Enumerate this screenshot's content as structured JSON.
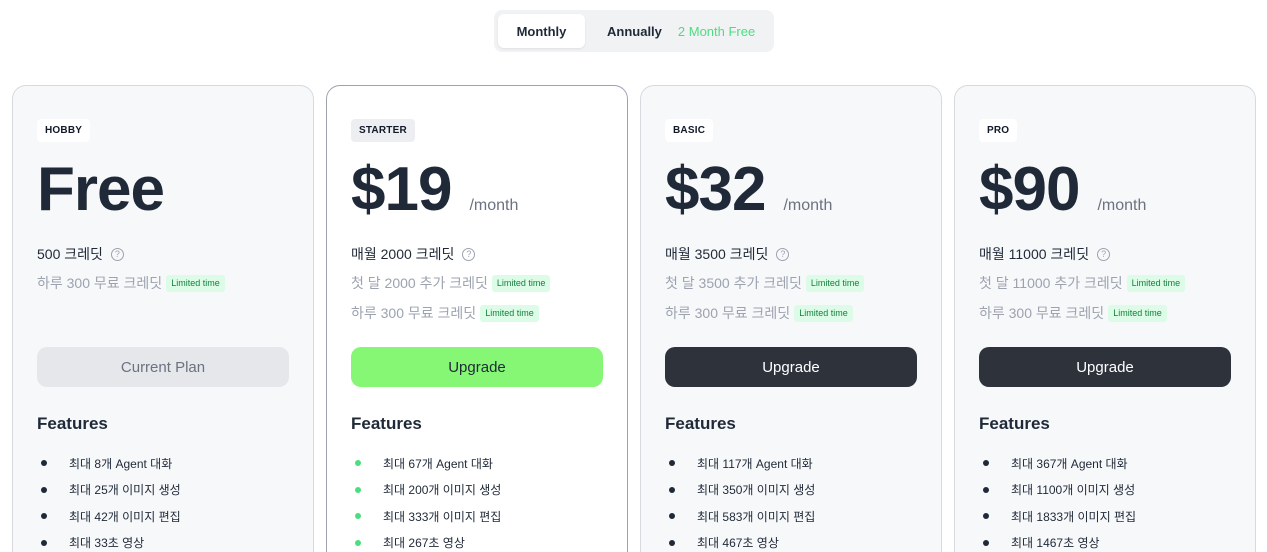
{
  "billing_toggle": {
    "monthly": "Monthly",
    "annually": "Annually",
    "promo": "2 Month Free"
  },
  "plans": [
    {
      "tag": "HOBBY",
      "price": "Free",
      "per": "",
      "credits": "500 크레딧",
      "extra": "하루 300 무료 크레딧",
      "extra_badge": "Limited time",
      "extra2": "",
      "extra2_badge": "",
      "cta": "Current Plan",
      "features_title": "Features",
      "features": [
        "최대 8개 Agent 대화",
        "최대 25개 이미지 생성",
        "최대 42개 이미지 편집",
        "최대 33초 영상"
      ]
    },
    {
      "tag": "STARTER",
      "price": "$19",
      "per": "/month",
      "credits": "매월 2000 크레딧",
      "extra": "첫 달 2000 추가 크레딧",
      "extra_badge": "Limited time",
      "extra2": "하루 300 무료 크레딧",
      "extra2_badge": "Limited time",
      "cta": "Upgrade",
      "features_title": "Features",
      "features": [
        "최대 67개 Agent 대화",
        "최대 200개 이미지 생성",
        "최대 333개 이미지 편집",
        "최대 267초 영상"
      ]
    },
    {
      "tag": "BASIC",
      "price": "$32",
      "per": "/month",
      "credits": "매월 3500 크레딧",
      "extra": "첫 달 3500 추가 크레딧",
      "extra_badge": "Limited time",
      "extra2": "하루 300 무료 크레딧",
      "extra2_badge": "Limited time",
      "cta": "Upgrade",
      "features_title": "Features",
      "features": [
        "최대 117개 Agent 대화",
        "최대 350개 이미지 생성",
        "최대 583개 이미지 편집",
        "최대 467초 영상"
      ]
    },
    {
      "tag": "PRO",
      "price": "$90",
      "per": "/month",
      "credits": "매월 11000 크레딧",
      "extra": "첫 달 11000 추가 크레딧",
      "extra_badge": "Limited time",
      "extra2": "하루 300 무료 크레딧",
      "extra2_badge": "Limited time",
      "cta": "Upgrade",
      "features_title": "Features",
      "features": [
        "최대 367개 Agent 대화",
        "최대 1100개 이미지 생성",
        "최대 1833개 이미지 편집",
        "최대 1467초 영상"
      ]
    }
  ],
  "help_glyph": "?",
  "colors": {
    "accent_green": "#86f775",
    "dark_button": "#2d323b",
    "promo_green": "#4ade80",
    "badge_bg": "#dcfce7"
  }
}
